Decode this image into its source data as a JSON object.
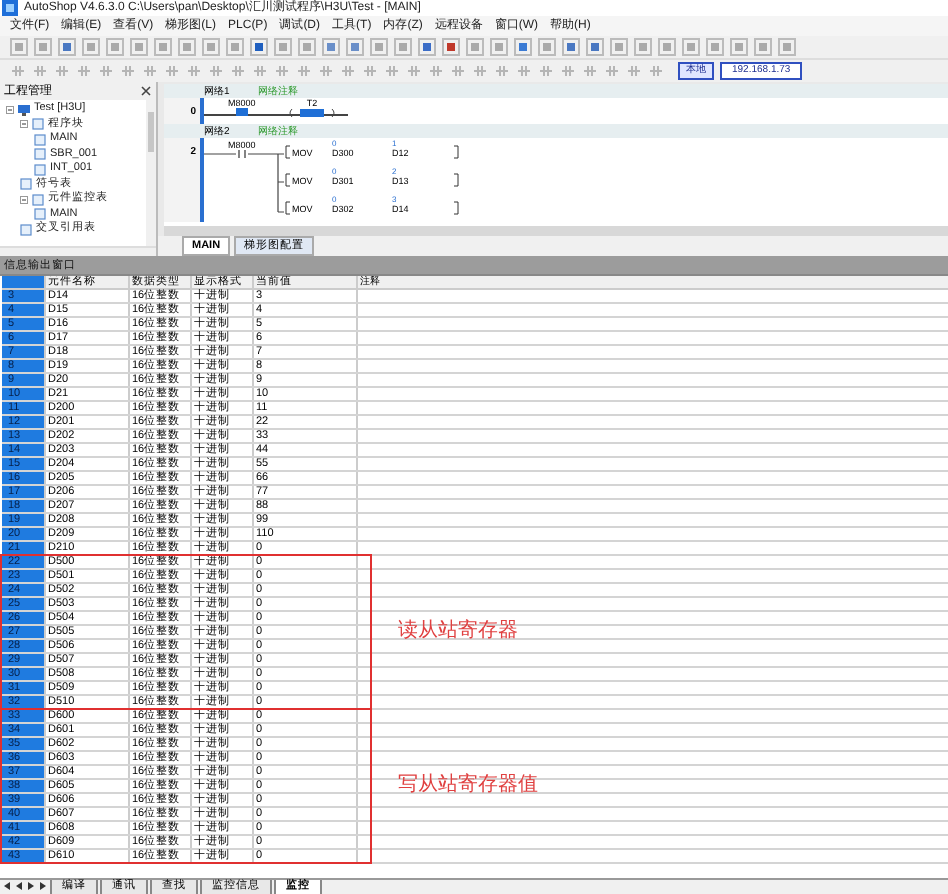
{
  "window": {
    "title": "AutoShop V4.6.3.0  C:\\Users\\pan\\Desktop\\汇川测试程序\\H3U\\Test - [MAIN]"
  },
  "menu": [
    "文件(F)",
    "编辑(E)",
    "查看(V)",
    "梯形图(L)",
    "PLC(P)",
    "调试(D)",
    "工具(T)",
    "内存(Z)",
    "远程设备",
    "窗口(W)",
    "帮助(H)"
  ],
  "toolbar": {
    "mode": "本地",
    "ip": "192.168.1.73"
  },
  "project": {
    "title": "工程管理",
    "tree": [
      {
        "label": "Test [H3U]",
        "children": [
          {
            "label": "程序块",
            "children": [
              {
                "label": "MAIN"
              },
              {
                "label": "SBR_001"
              },
              {
                "label": "INT_001"
              }
            ]
          },
          {
            "label": "符号表"
          },
          {
            "label": "元件监控表",
            "children": [
              {
                "label": "MAIN"
              }
            ]
          },
          {
            "label": "交叉引用表"
          }
        ]
      }
    ]
  },
  "ladder": {
    "networks": [
      {
        "label": "网络1",
        "comment": "网络注释",
        "step": "0",
        "contact": "M8000",
        "coil": "T2"
      },
      {
        "label": "网络2",
        "comment": "网络注释",
        "step": "2",
        "contact": "M8000",
        "movs": [
          {
            "op": "MOV",
            "src": "D300",
            "dst": "D12",
            "src_val": "0",
            "dst_val": "1"
          },
          {
            "op": "MOV",
            "src": "D301",
            "dst": "D13",
            "src_val": "0",
            "dst_val": "2"
          },
          {
            "op": "MOV",
            "src": "D302",
            "dst": "D14",
            "src_val": "0",
            "dst_val": "3"
          }
        ]
      }
    ]
  },
  "editor_tabs": [
    {
      "label": "MAIN",
      "selected": true
    },
    {
      "label": "梯形图配置",
      "selected": false
    }
  ],
  "output": {
    "title": "信息输出窗口",
    "columns": [
      "",
      "元件名称",
      "数据类型",
      "显示格式",
      "当前值",
      "注释"
    ],
    "sections": [
      {
        "rows": [
          [
            "3",
            "D14",
            "16位整数",
            "十进制",
            "3"
          ],
          [
            "4",
            "D15",
            "16位整数",
            "十进制",
            "4"
          ],
          [
            "5",
            "D16",
            "16位整数",
            "十进制",
            "5"
          ],
          [
            "6",
            "D17",
            "16位整数",
            "十进制",
            "6"
          ],
          [
            "7",
            "D18",
            "16位整数",
            "十进制",
            "7"
          ],
          [
            "8",
            "D19",
            "16位整数",
            "十进制",
            "8"
          ],
          [
            "9",
            "D20",
            "16位整数",
            "十进制",
            "9"
          ],
          [
            "10",
            "D21",
            "16位整数",
            "十进制",
            "10"
          ],
          [
            "11",
            "D200",
            "16位整数",
            "十进制",
            "11"
          ],
          [
            "12",
            "D201",
            "16位整数",
            "十进制",
            "22"
          ],
          [
            "13",
            "D202",
            "16位整数",
            "十进制",
            "33"
          ],
          [
            "14",
            "D203",
            "16位整数",
            "十进制",
            "44"
          ],
          [
            "15",
            "D204",
            "16位整数",
            "十进制",
            "55"
          ],
          [
            "16",
            "D205",
            "16位整数",
            "十进制",
            "66"
          ],
          [
            "17",
            "D206",
            "16位整数",
            "十进制",
            "77"
          ],
          [
            "18",
            "D207",
            "16位整数",
            "十进制",
            "88"
          ],
          [
            "19",
            "D208",
            "16位整数",
            "十进制",
            "99"
          ],
          [
            "20",
            "D209",
            "16位整数",
            "十进制",
            "110"
          ],
          [
            "21",
            "D210",
            "16位整数",
            "十进制",
            "0"
          ]
        ]
      },
      {
        "annotation": "读从站寄存器",
        "rows": [
          [
            "22",
            "D500",
            "16位整数",
            "十进制",
            "0"
          ],
          [
            "23",
            "D501",
            "16位整数",
            "十进制",
            "0"
          ],
          [
            "24",
            "D502",
            "16位整数",
            "十进制",
            "0"
          ],
          [
            "25",
            "D503",
            "16位整数",
            "十进制",
            "0"
          ],
          [
            "26",
            "D504",
            "16位整数",
            "十进制",
            "0"
          ],
          [
            "27",
            "D505",
            "16位整数",
            "十进制",
            "0"
          ],
          [
            "28",
            "D506",
            "16位整数",
            "十进制",
            "0"
          ],
          [
            "29",
            "D507",
            "16位整数",
            "十进制",
            "0"
          ],
          [
            "30",
            "D508",
            "16位整数",
            "十进制",
            "0"
          ],
          [
            "31",
            "D509",
            "16位整数",
            "十进制",
            "0"
          ],
          [
            "32",
            "D510",
            "16位整数",
            "十进制",
            "0"
          ]
        ]
      },
      {
        "annotation": "写从站寄存器值",
        "rows": [
          [
            "33",
            "D600",
            "16位整数",
            "十进制",
            "0"
          ],
          [
            "34",
            "D601",
            "16位整数",
            "十进制",
            "0"
          ],
          [
            "35",
            "D602",
            "16位整数",
            "十进制",
            "0"
          ],
          [
            "36",
            "D603",
            "16位整数",
            "十进制",
            "0"
          ],
          [
            "37",
            "D604",
            "16位整数",
            "十进制",
            "0"
          ],
          [
            "38",
            "D605",
            "16位整数",
            "十进制",
            "0"
          ],
          [
            "39",
            "D606",
            "16位整数",
            "十进制",
            "0"
          ],
          [
            "40",
            "D607",
            "16位整数",
            "十进制",
            "0"
          ],
          [
            "41",
            "D608",
            "16位整数",
            "十进制",
            "0"
          ],
          [
            "42",
            "D609",
            "16位整数",
            "十进制",
            "0"
          ],
          [
            "43",
            "D610",
            "16位整数",
            "十进制",
            "0"
          ]
        ]
      }
    ]
  },
  "bottom_tabs": [
    {
      "label": "编译",
      "selected": false
    },
    {
      "label": "通讯",
      "selected": false
    },
    {
      "label": "查找",
      "selected": false
    },
    {
      "label": "监控信息",
      "selected": false
    },
    {
      "label": "监控",
      "selected": true
    }
  ]
}
